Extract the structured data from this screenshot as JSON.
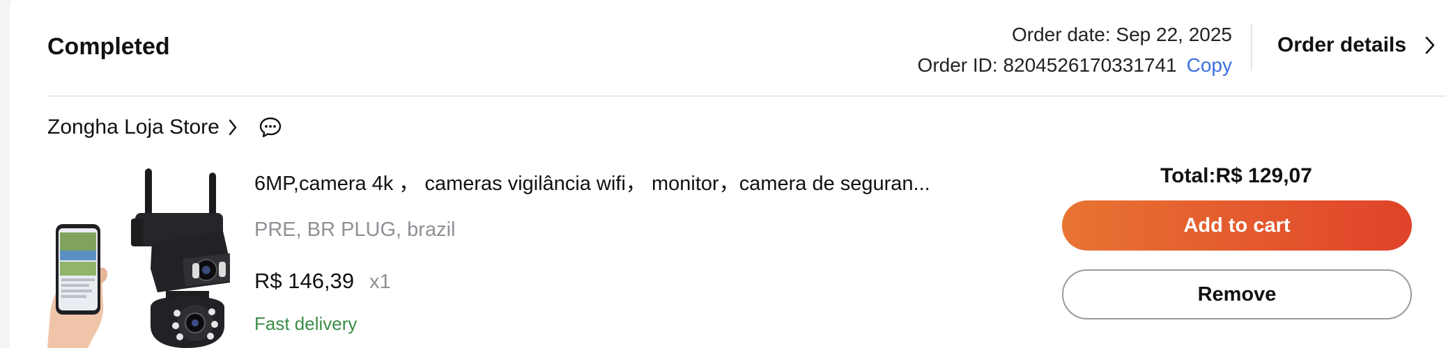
{
  "order": {
    "status": "Completed",
    "date_line": "Order date: Sep 22, 2025",
    "id_label": "Order ID: 8204526170331741",
    "copy_label": "Copy",
    "details_label": "Order details"
  },
  "store": {
    "name": "Zongha Loja Store"
  },
  "product": {
    "title": "6MP,camera 4k ， cameras vigilância wifi，  monitor，camera de seguran...",
    "variant": "PRE, BR PLUG, brazil",
    "price": "R$ 146,39",
    "quantity": "x1",
    "delivery": "Fast delivery"
  },
  "summary": {
    "total": "Total:R$ 129,07",
    "add_to_cart": "Add to cart",
    "remove": "Remove"
  },
  "colors": {
    "accent_start": "#e87432",
    "accent_end": "#e0432a",
    "link": "#3b6fe0",
    "delivery": "#3a8d48"
  },
  "icons": [
    "chevron-right-icon",
    "chat-bubble-icon"
  ]
}
